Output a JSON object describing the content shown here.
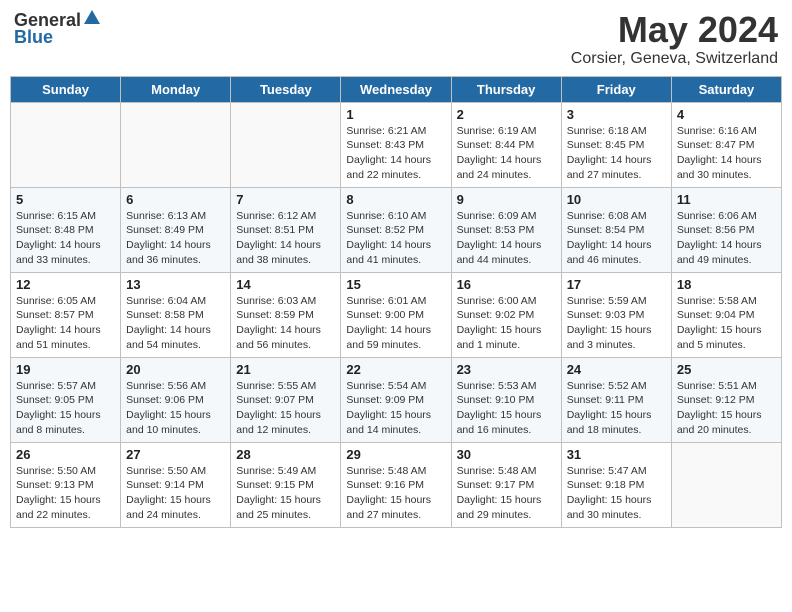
{
  "header": {
    "logo_general": "General",
    "logo_blue": "Blue",
    "title": "May 2024",
    "subtitle": "Corsier, Geneva, Switzerland"
  },
  "days_of_week": [
    "Sunday",
    "Monday",
    "Tuesday",
    "Wednesday",
    "Thursday",
    "Friday",
    "Saturday"
  ],
  "weeks": [
    [
      {
        "day": "",
        "detail": ""
      },
      {
        "day": "",
        "detail": ""
      },
      {
        "day": "",
        "detail": ""
      },
      {
        "day": "1",
        "detail": "Sunrise: 6:21 AM\nSunset: 8:43 PM\nDaylight: 14 hours\nand 22 minutes."
      },
      {
        "day": "2",
        "detail": "Sunrise: 6:19 AM\nSunset: 8:44 PM\nDaylight: 14 hours\nand 24 minutes."
      },
      {
        "day": "3",
        "detail": "Sunrise: 6:18 AM\nSunset: 8:45 PM\nDaylight: 14 hours\nand 27 minutes."
      },
      {
        "day": "4",
        "detail": "Sunrise: 6:16 AM\nSunset: 8:47 PM\nDaylight: 14 hours\nand 30 minutes."
      }
    ],
    [
      {
        "day": "5",
        "detail": "Sunrise: 6:15 AM\nSunset: 8:48 PM\nDaylight: 14 hours\nand 33 minutes."
      },
      {
        "day": "6",
        "detail": "Sunrise: 6:13 AM\nSunset: 8:49 PM\nDaylight: 14 hours\nand 36 minutes."
      },
      {
        "day": "7",
        "detail": "Sunrise: 6:12 AM\nSunset: 8:51 PM\nDaylight: 14 hours\nand 38 minutes."
      },
      {
        "day": "8",
        "detail": "Sunrise: 6:10 AM\nSunset: 8:52 PM\nDaylight: 14 hours\nand 41 minutes."
      },
      {
        "day": "9",
        "detail": "Sunrise: 6:09 AM\nSunset: 8:53 PM\nDaylight: 14 hours\nand 44 minutes."
      },
      {
        "day": "10",
        "detail": "Sunrise: 6:08 AM\nSunset: 8:54 PM\nDaylight: 14 hours\nand 46 minutes."
      },
      {
        "day": "11",
        "detail": "Sunrise: 6:06 AM\nSunset: 8:56 PM\nDaylight: 14 hours\nand 49 minutes."
      }
    ],
    [
      {
        "day": "12",
        "detail": "Sunrise: 6:05 AM\nSunset: 8:57 PM\nDaylight: 14 hours\nand 51 minutes."
      },
      {
        "day": "13",
        "detail": "Sunrise: 6:04 AM\nSunset: 8:58 PM\nDaylight: 14 hours\nand 54 minutes."
      },
      {
        "day": "14",
        "detail": "Sunrise: 6:03 AM\nSunset: 8:59 PM\nDaylight: 14 hours\nand 56 minutes."
      },
      {
        "day": "15",
        "detail": "Sunrise: 6:01 AM\nSunset: 9:00 PM\nDaylight: 14 hours\nand 59 minutes."
      },
      {
        "day": "16",
        "detail": "Sunrise: 6:00 AM\nSunset: 9:02 PM\nDaylight: 15 hours\nand 1 minute."
      },
      {
        "day": "17",
        "detail": "Sunrise: 5:59 AM\nSunset: 9:03 PM\nDaylight: 15 hours\nand 3 minutes."
      },
      {
        "day": "18",
        "detail": "Sunrise: 5:58 AM\nSunset: 9:04 PM\nDaylight: 15 hours\nand 5 minutes."
      }
    ],
    [
      {
        "day": "19",
        "detail": "Sunrise: 5:57 AM\nSunset: 9:05 PM\nDaylight: 15 hours\nand 8 minutes."
      },
      {
        "day": "20",
        "detail": "Sunrise: 5:56 AM\nSunset: 9:06 PM\nDaylight: 15 hours\nand 10 minutes."
      },
      {
        "day": "21",
        "detail": "Sunrise: 5:55 AM\nSunset: 9:07 PM\nDaylight: 15 hours\nand 12 minutes."
      },
      {
        "day": "22",
        "detail": "Sunrise: 5:54 AM\nSunset: 9:09 PM\nDaylight: 15 hours\nand 14 minutes."
      },
      {
        "day": "23",
        "detail": "Sunrise: 5:53 AM\nSunset: 9:10 PM\nDaylight: 15 hours\nand 16 minutes."
      },
      {
        "day": "24",
        "detail": "Sunrise: 5:52 AM\nSunset: 9:11 PM\nDaylight: 15 hours\nand 18 minutes."
      },
      {
        "day": "25",
        "detail": "Sunrise: 5:51 AM\nSunset: 9:12 PM\nDaylight: 15 hours\nand 20 minutes."
      }
    ],
    [
      {
        "day": "26",
        "detail": "Sunrise: 5:50 AM\nSunset: 9:13 PM\nDaylight: 15 hours\nand 22 minutes."
      },
      {
        "day": "27",
        "detail": "Sunrise: 5:50 AM\nSunset: 9:14 PM\nDaylight: 15 hours\nand 24 minutes."
      },
      {
        "day": "28",
        "detail": "Sunrise: 5:49 AM\nSunset: 9:15 PM\nDaylight: 15 hours\nand 25 minutes."
      },
      {
        "day": "29",
        "detail": "Sunrise: 5:48 AM\nSunset: 9:16 PM\nDaylight: 15 hours\nand 27 minutes."
      },
      {
        "day": "30",
        "detail": "Sunrise: 5:48 AM\nSunset: 9:17 PM\nDaylight: 15 hours\nand 29 minutes."
      },
      {
        "day": "31",
        "detail": "Sunrise: 5:47 AM\nSunset: 9:18 PM\nDaylight: 15 hours\nand 30 minutes."
      },
      {
        "day": "",
        "detail": ""
      }
    ]
  ]
}
